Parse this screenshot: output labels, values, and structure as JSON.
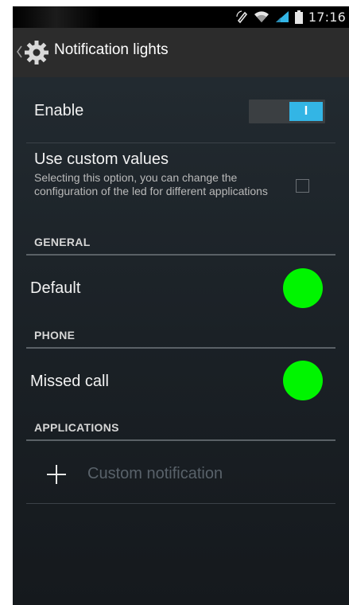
{
  "status_bar": {
    "time": "17:16",
    "icons": [
      "rotation-lock-icon",
      "wifi-icon",
      "signal-icon",
      "battery-icon"
    ]
  },
  "action_bar": {
    "title": "Notification lights",
    "icon": "gear-icon",
    "up_icon": "chevron-left-icon"
  },
  "enable": {
    "label": "Enable",
    "switch_on_text": "I",
    "switch_state": "on"
  },
  "custom_values": {
    "title": "Use custom values",
    "summary": "Selecting this option, you can change the configuration of the led for different applications",
    "checked": false
  },
  "sections": {
    "general": {
      "header": "GENERAL",
      "items": [
        {
          "label": "Default",
          "led_color": "#00f500"
        }
      ]
    },
    "phone": {
      "header": "PHONE",
      "items": [
        {
          "label": "Missed call",
          "led_color": "#00f500"
        }
      ]
    },
    "applications": {
      "header": "APPLICATIONS",
      "add_label": "Custom notification",
      "add_icon": "plus-icon"
    }
  },
  "colors": {
    "accent": "#33b5e5",
    "led_green": "#00f500",
    "action_bar_bg": "#2c2c2c"
  }
}
